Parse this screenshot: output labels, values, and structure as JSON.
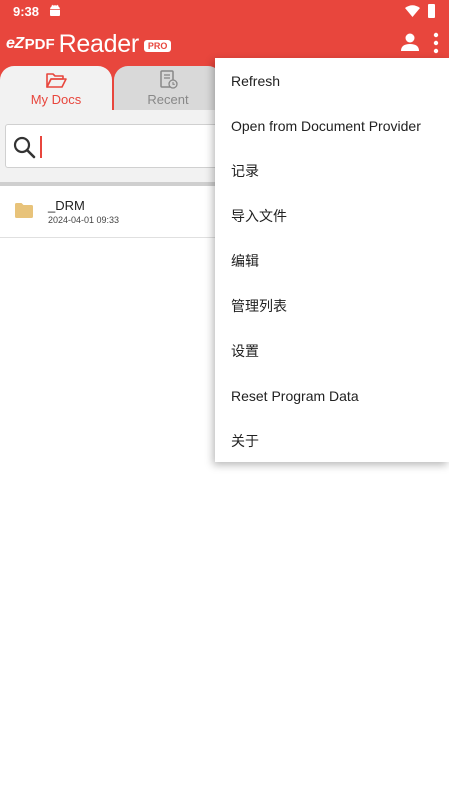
{
  "status_bar": {
    "time": "9:38",
    "icons": [
      "android-icon",
      "wifi-icon",
      "battery-icon"
    ]
  },
  "app_bar": {
    "logo": {
      "ez": "eZ",
      "pdf": "PDF",
      "reader": "Reader",
      "badge": "PRO"
    },
    "icons": [
      "user-icon",
      "overflow-menu-icon"
    ],
    "color": "#e8463d"
  },
  "tabs": [
    {
      "label": "My Docs",
      "icon": "folder-open-icon",
      "selected": true
    },
    {
      "label": "Recent",
      "icon": "recent-document-icon",
      "selected": false
    }
  ],
  "search": {
    "value": "",
    "placeholder": ""
  },
  "files": [
    {
      "name": "_DRM",
      "date": "2024-04-01 09:33",
      "icon": "folder-icon",
      "icon_color": "#e8c37a"
    }
  ],
  "menu": {
    "items": [
      "Refresh",
      "Open from Document Provider",
      "记录",
      "导入文件",
      "编辑",
      "管理列表",
      "设置",
      "Reset Program Data",
      "关于"
    ]
  }
}
